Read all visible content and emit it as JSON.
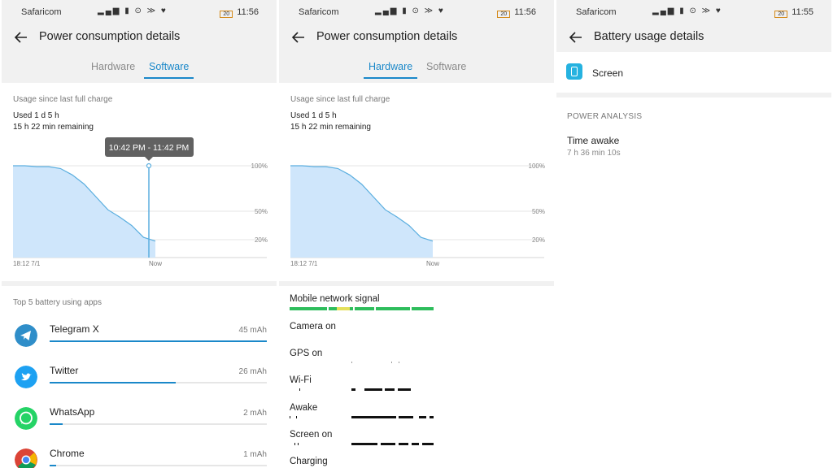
{
  "colors": {
    "accent": "#1a88c9",
    "chart_fill": "#cfe6fb",
    "chart_line": "#5aaedf",
    "background_gray": "#f1f1f1",
    "signal_green": "#2ebd5c",
    "signal_yellow": "#e4e05a",
    "screen_icon": "#25b2e0",
    "telegram": "#2f8ec9",
    "twitter": "#1da1f2",
    "whatsapp": "#25d366"
  },
  "panels": [
    {
      "status": {
        "carrier": "Safaricom",
        "battery": "20",
        "time": "11:56"
      },
      "title": "Power consumption details",
      "tabs": [
        {
          "label": "Hardware"
        },
        {
          "label": "Software"
        }
      ],
      "active_tab": 1,
      "usage_label": "Usage since last full charge",
      "used": "Used 1 d 5 h",
      "remaining": "15 h 22 min remaining",
      "tooltip": "10:42 PM - 11:42 PM",
      "chart_labels": {
        "y_100": "100%",
        "y_50": "50%",
        "y_20": "20%",
        "x_start": "18:12  7/1",
        "x_now": "Now"
      },
      "top5_label": "Top 5 battery using apps",
      "apps": [
        {
          "name": "Telegram X",
          "value": "45 mAh",
          "fraction": 1.0,
          "icon": "telegram-icon"
        },
        {
          "name": "Twitter",
          "value": "26 mAh",
          "fraction": 0.58,
          "icon": "twitter-icon"
        },
        {
          "name": "WhatsApp",
          "value": "2 mAh",
          "fraction": 0.06,
          "icon": "whatsapp-icon"
        },
        {
          "name": "Chrome",
          "value": "1 mAh",
          "fraction": 0.03,
          "icon": "chrome-icon"
        }
      ]
    },
    {
      "status": {
        "carrier": "Safaricom",
        "battery": "20",
        "time": "11:56"
      },
      "title": "Power consumption details",
      "tabs": [
        {
          "label": "Hardware"
        },
        {
          "label": "Software"
        }
      ],
      "active_tab": 0,
      "usage_label": "Usage since last full charge",
      "used": "Used 1 d 5 h",
      "remaining": "15 h 22 min remaining",
      "chart_labels": {
        "y_100": "100%",
        "y_50": "50%",
        "y_20": "20%",
        "x_start": "18:12  7/1",
        "x_now": "Now"
      },
      "hardware": [
        {
          "label": "Mobile network signal"
        },
        {
          "label": "Camera on"
        },
        {
          "label": "GPS on"
        },
        {
          "label": "Wi-Fi"
        },
        {
          "label": "Awake"
        },
        {
          "label": "Screen on"
        },
        {
          "label": "Charging"
        }
      ]
    },
    {
      "status": {
        "carrier": "Safaricom",
        "battery": "20",
        "time": "11:55"
      },
      "title": "Battery usage details",
      "item": "Screen",
      "power_analysis": "POWER ANALYSIS",
      "time_awake_title": "Time awake",
      "time_awake_value": "7 h 36 min 10s"
    }
  ],
  "chart_data": [
    {
      "type": "area",
      "x": [
        "18:12 7/1",
        "",
        "",
        "",
        "",
        "",
        "",
        "",
        "",
        "",
        "",
        "",
        "Now"
      ],
      "series": [
        {
          "values": [
            100,
            100,
            99,
            99,
            97,
            90,
            80,
            66,
            52,
            44,
            35,
            22,
            18
          ]
        }
      ],
      "ylim": [
        0,
        100
      ],
      "y_ticks": [
        "100%",
        "50%",
        "20%"
      ],
      "legend": "none"
    },
    {
      "type": "area",
      "x": [
        "18:12 7/1",
        "",
        "",
        "",
        "",
        "",
        "",
        "",
        "",
        "",
        "",
        "",
        "Now"
      ],
      "series": [
        {
          "values": [
            100,
            100,
            99,
            99,
            97,
            90,
            80,
            66,
            52,
            44,
            35,
            22,
            18
          ]
        }
      ],
      "ylim": [
        0,
        100
      ],
      "y_ticks": [
        "100%",
        "50%",
        "20%"
      ],
      "legend": "none"
    }
  ]
}
